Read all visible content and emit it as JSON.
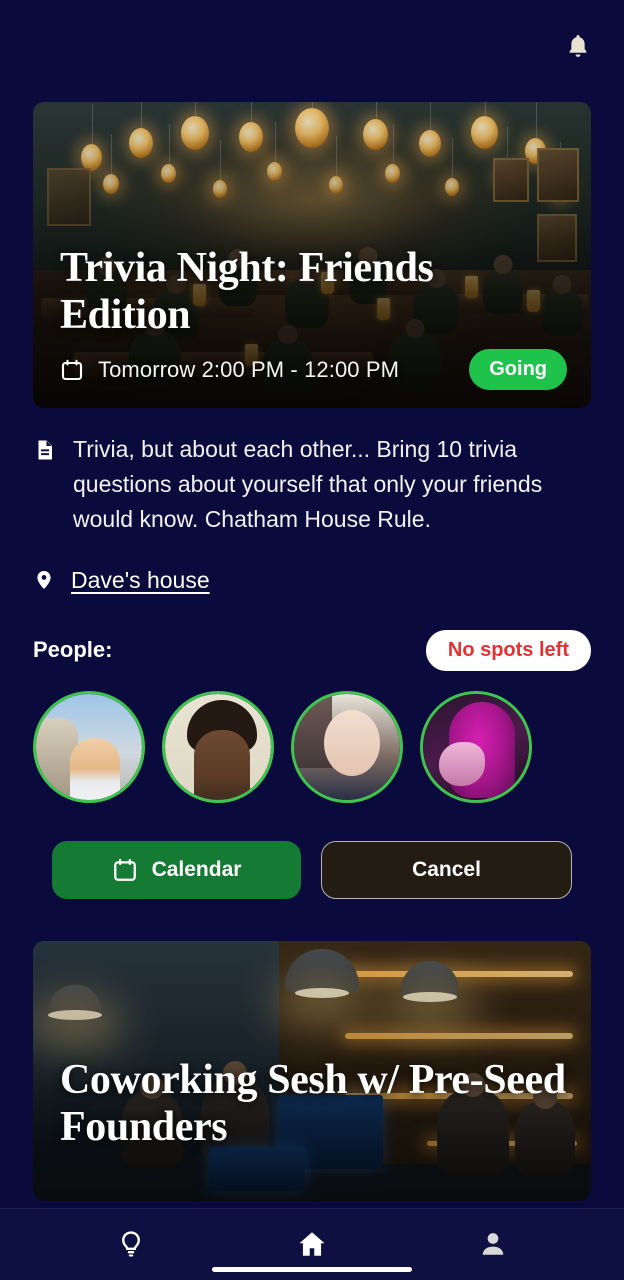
{
  "app": {
    "background_color": "#0a0a3c",
    "accent_green": "#1fc24a",
    "alert_red": "#e33232"
  },
  "topbar": {
    "notification_icon": "bell-icon"
  },
  "event": {
    "title": "Trivia Night: Friends Edition",
    "date_icon": "calendar-icon",
    "date_text": "Tomorrow 2:00 PM - 12:00 PM",
    "rsvp_status": "Going",
    "description_icon": "document-icon",
    "description": "Trivia, but about each other... Bring 10 trivia questions about yourself that only your friends would know. Chatham House Rule.",
    "location_icon": "map-pin-icon",
    "location": "Dave's house",
    "people_label": "People:",
    "spots_badge": "No spots left",
    "attendees": [
      {
        "name": "attendee-1"
      },
      {
        "name": "attendee-2"
      },
      {
        "name": "attendee-3"
      },
      {
        "name": "attendee-4"
      }
    ],
    "actions": {
      "calendar_label": "Calendar",
      "calendar_icon": "calendar-icon",
      "cancel_label": "Cancel"
    }
  },
  "next_event": {
    "title": "Coworking Sesh w/ Pre-Seed Founders"
  },
  "bottom_nav": {
    "items": [
      {
        "icon": "lightbulb-icon",
        "active": false
      },
      {
        "icon": "home-icon",
        "active": true
      },
      {
        "icon": "person-icon",
        "active": false
      }
    ]
  }
}
